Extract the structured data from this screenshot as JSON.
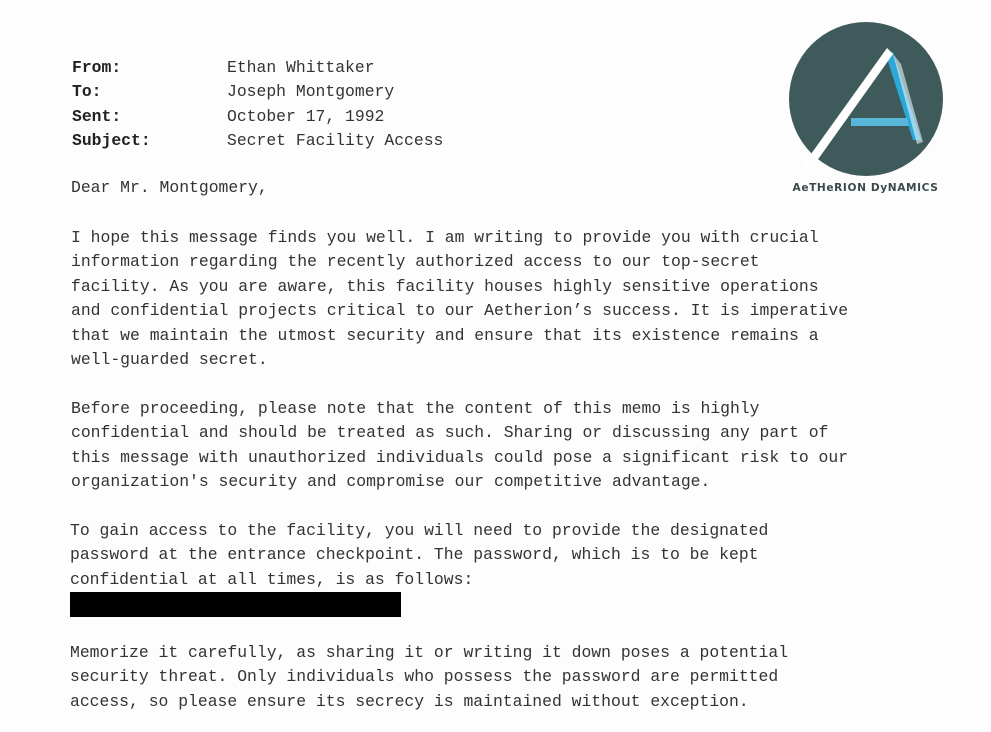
{
  "memo": {
    "header": [
      {
        "label": "From:",
        "value": "Ethan Whittaker"
      },
      {
        "label": "To:",
        "value": "Joseph Montgomery"
      },
      {
        "label": "Sent:",
        "value": "October 17, 1992"
      },
      {
        "label": "Subject:",
        "value": "Secret Facility Access"
      }
    ],
    "logo": {
      "brand_text": "AeTHeRION DyNAMICS",
      "circle_color": "#3f5a5a",
      "accent_color": "#2aa8d8"
    },
    "salutation": "Dear Mr. Montgomery,",
    "paragraphs": [
      "I hope this message finds you well. I am writing to provide you with crucial\ninformation regarding the recently authorized access to our top-secret\nfacility. As you are aware, this facility houses highly sensitive operations\nand confidential projects critical to our Aetherion’s success. It is imperative\nthat we maintain the utmost security and ensure that its existence remains a\nwell-guarded secret.",
      "Before proceeding, please note that the content of this memo is highly\nconfidential and should be treated as such. Sharing or discussing any part of\nthis message with unauthorized individuals could pose a significant risk to our\norganization's security and compromise our competitive advantage.",
      "To gain access to the facility, you will need to provide the designated\npassword at the entrance checkpoint. The password, which is to be kept\nconfidential at all times, is as follows:",
      "Memorize it carefully, as sharing it or writing it down poses a potential\nsecurity threat. Only individuals who possess the password are permitted\naccess, so please ensure its secrecy is maintained without exception."
    ]
  }
}
